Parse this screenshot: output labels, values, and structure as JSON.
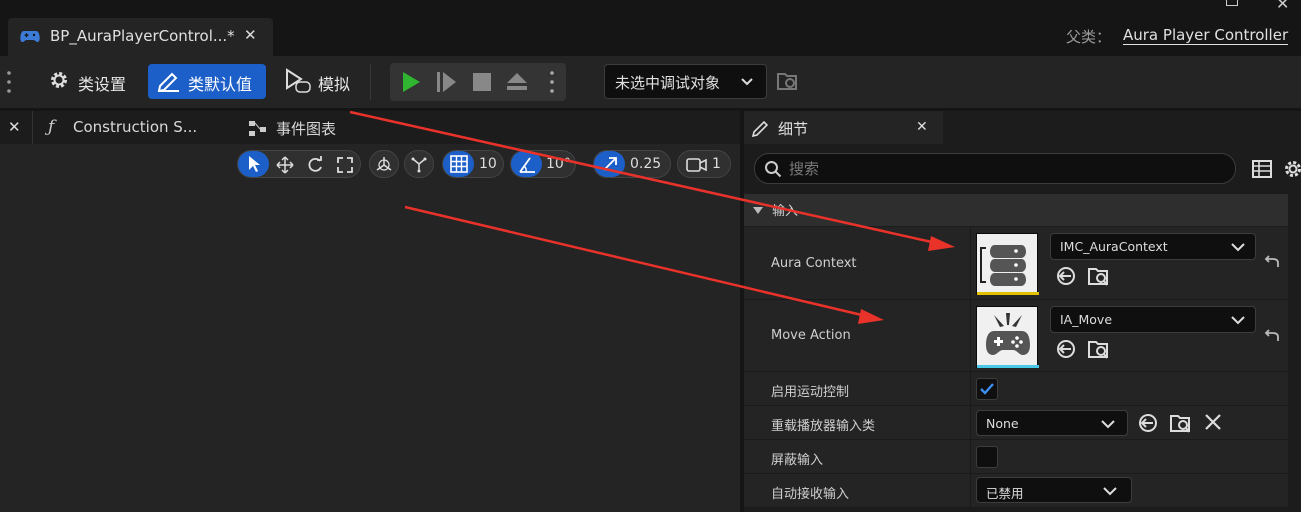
{
  "window": {
    "tab_title": "BP_AuraPlayerControl...*",
    "parent_label": "父类：",
    "parent_value": "Aura Player Controller"
  },
  "toolbar": {
    "class_settings": "类设置",
    "class_defaults": "类默认值",
    "simulate": "模拟",
    "debug_target": "未选中调试对象"
  },
  "editor_tabs": {
    "construction": "Construction S...",
    "event_graph": "事件图表"
  },
  "viewport_toolbar": {
    "grid_size": "10",
    "rotation_snap": "10°",
    "scale_snap": "0.25",
    "camera_speed": "1"
  },
  "details": {
    "tab_title": "细节",
    "search_placeholder": "搜索",
    "section_title": "输入",
    "rows": [
      {
        "label": "Aura Context",
        "value": "IMC_AuraContext"
      },
      {
        "label": "Move Action",
        "value": "IA_Move"
      },
      {
        "label": "启用运动控制",
        "checked": true
      },
      {
        "label": "重载播放器输入类",
        "value": "None"
      },
      {
        "label": "屏蔽输入",
        "checked": false
      },
      {
        "label": "自动接收输入",
        "value": "已禁用"
      }
    ]
  },
  "colors": {
    "accent_blue": "#1d5fc8",
    "play_green": "#2fb52f",
    "annotation_red": "#e8322a"
  }
}
